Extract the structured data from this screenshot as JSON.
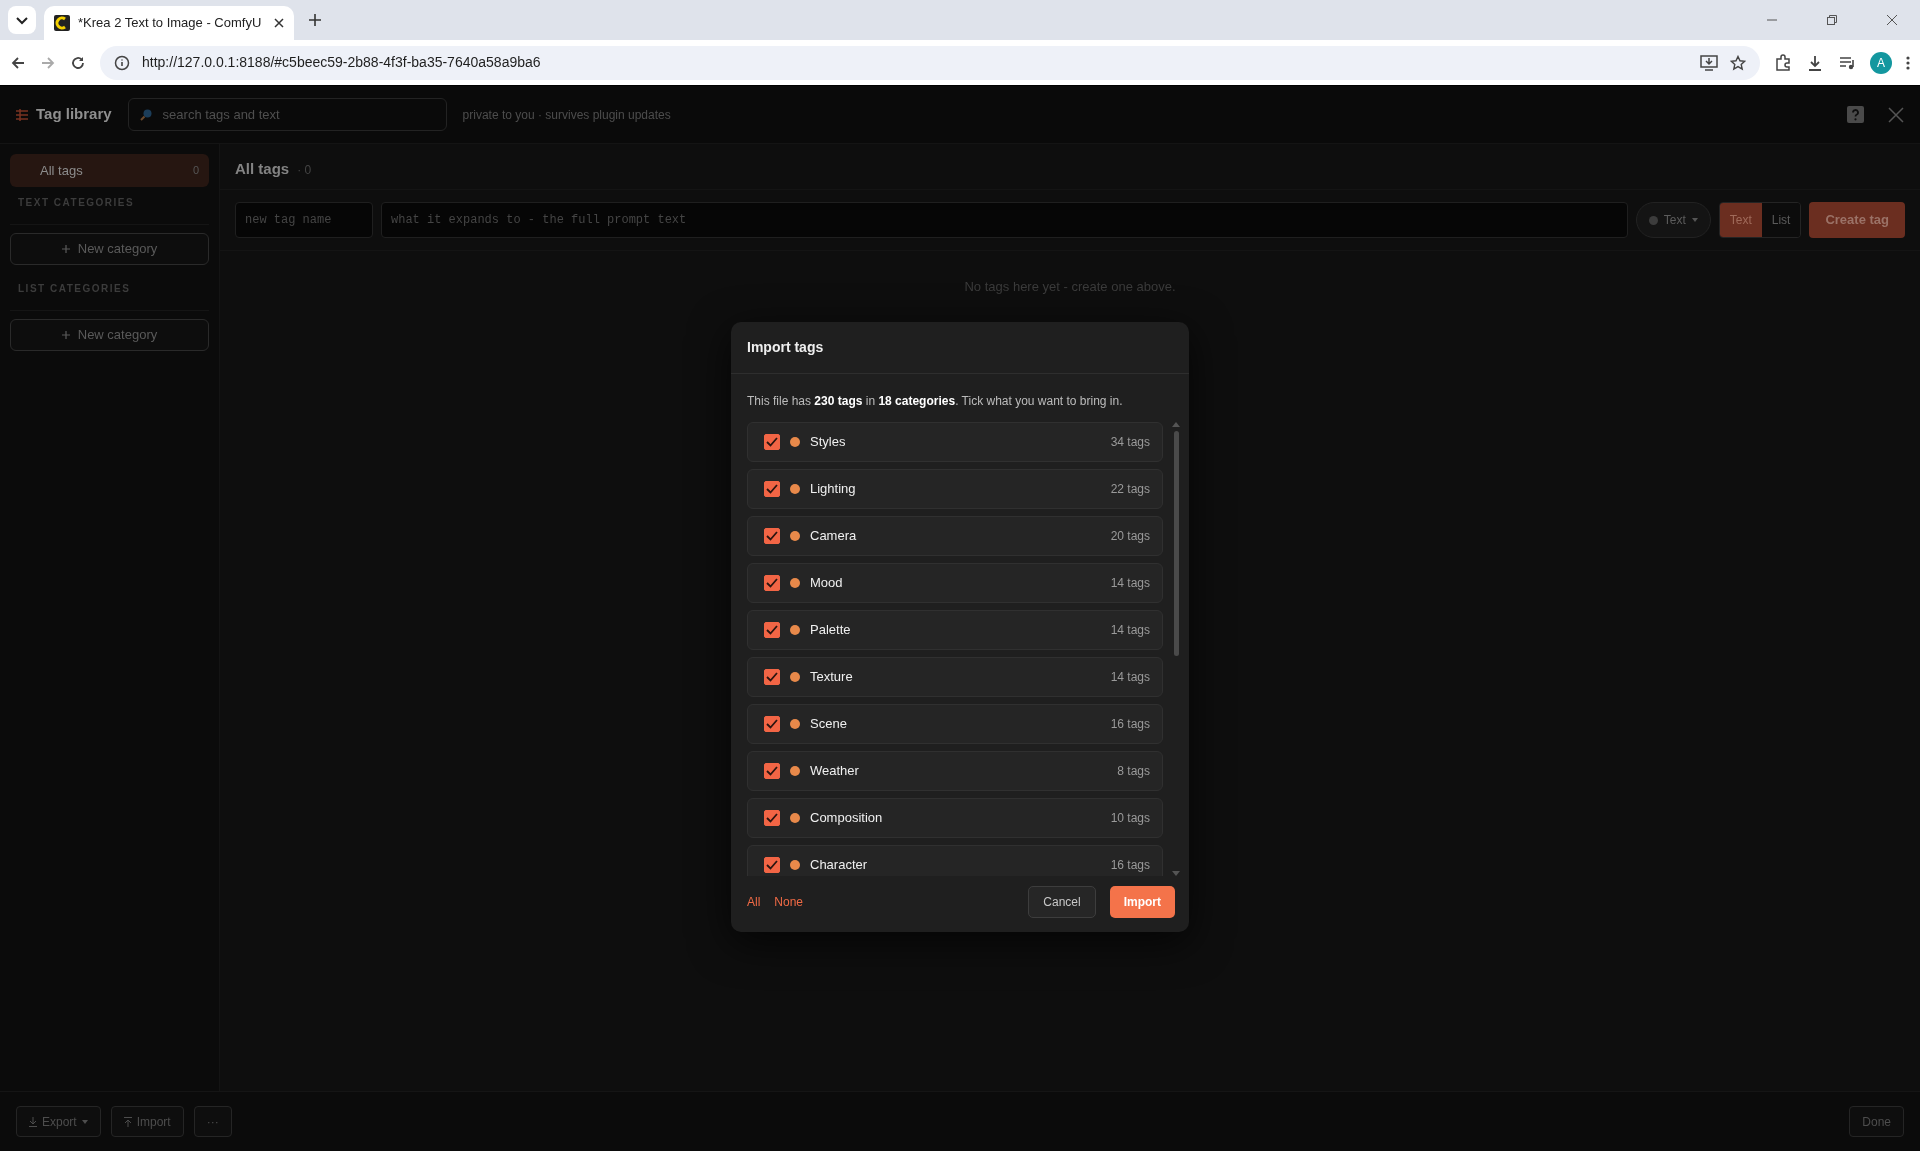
{
  "browser": {
    "tabs": [
      {
        "title": "*Krea 2 Text to Image - ComfyU",
        "selected": true
      }
    ],
    "url": "http://127.0.0.1:8188/#c5beec59-2b88-4f3f-ba35-7640a58a9ba6",
    "profile_initial": "A"
  },
  "app": {
    "title": "Tag library",
    "search": {
      "placeholder": "search tags and text"
    },
    "note": "private to you · survives plugin updates"
  },
  "sidebar": {
    "all_tags": {
      "label": "All tags",
      "count": "0",
      "selected": true
    },
    "sections": [
      {
        "heading": "TEXT CATEGORIES",
        "button": "New category"
      },
      {
        "heading": "LIST CATEGORIES",
        "button": "New category"
      }
    ]
  },
  "main": {
    "heading": "All tags",
    "count": "· 0",
    "name_field": {
      "placeholder": "new tag name"
    },
    "text_field": {
      "placeholder": "what it expands to - the full prompt text"
    },
    "category_dropdown": "Text",
    "modes": [
      {
        "label": "Text",
        "selected": true
      },
      {
        "label": "List",
        "selected": false
      }
    ],
    "create_button": "Create tag",
    "empty_message": "No tags here yet - create one above."
  },
  "footer": {
    "export_button": "Export",
    "import_button": "Import",
    "more_button": "···",
    "done_button": "Done"
  },
  "modal": {
    "title": "Import tags",
    "summary": "This file has **230 tags** in **18 categories**. Tick what you want to bring in.",
    "categories": [
      {
        "name": "Styles",
        "count": "34 tags",
        "checked": true,
        "color": "#e8894a"
      },
      {
        "name": "Lighting",
        "count": "22 tags",
        "checked": true,
        "color": "#e8894a"
      },
      {
        "name": "Camera",
        "count": "20 tags",
        "checked": true,
        "color": "#e8894a"
      },
      {
        "name": "Mood",
        "count": "14 tags",
        "checked": true,
        "color": "#e8894a"
      },
      {
        "name": "Palette",
        "count": "14 tags",
        "checked": true,
        "color": "#e8894a"
      },
      {
        "name": "Texture",
        "count": "14 tags",
        "checked": true,
        "color": "#e8894a"
      },
      {
        "name": "Scene",
        "count": "16 tags",
        "checked": true,
        "color": "#e8894a"
      },
      {
        "name": "Weather",
        "count": "8 tags",
        "checked": true,
        "color": "#e8894a"
      },
      {
        "name": "Composition",
        "count": "10 tags",
        "checked": true,
        "color": "#e8894a"
      },
      {
        "name": "Character",
        "count": "16 tags",
        "checked": true,
        "color": "#e8894a"
      }
    ],
    "links": [
      "All",
      "None"
    ],
    "cancel_button": "Cancel",
    "import_button": "Import"
  }
}
